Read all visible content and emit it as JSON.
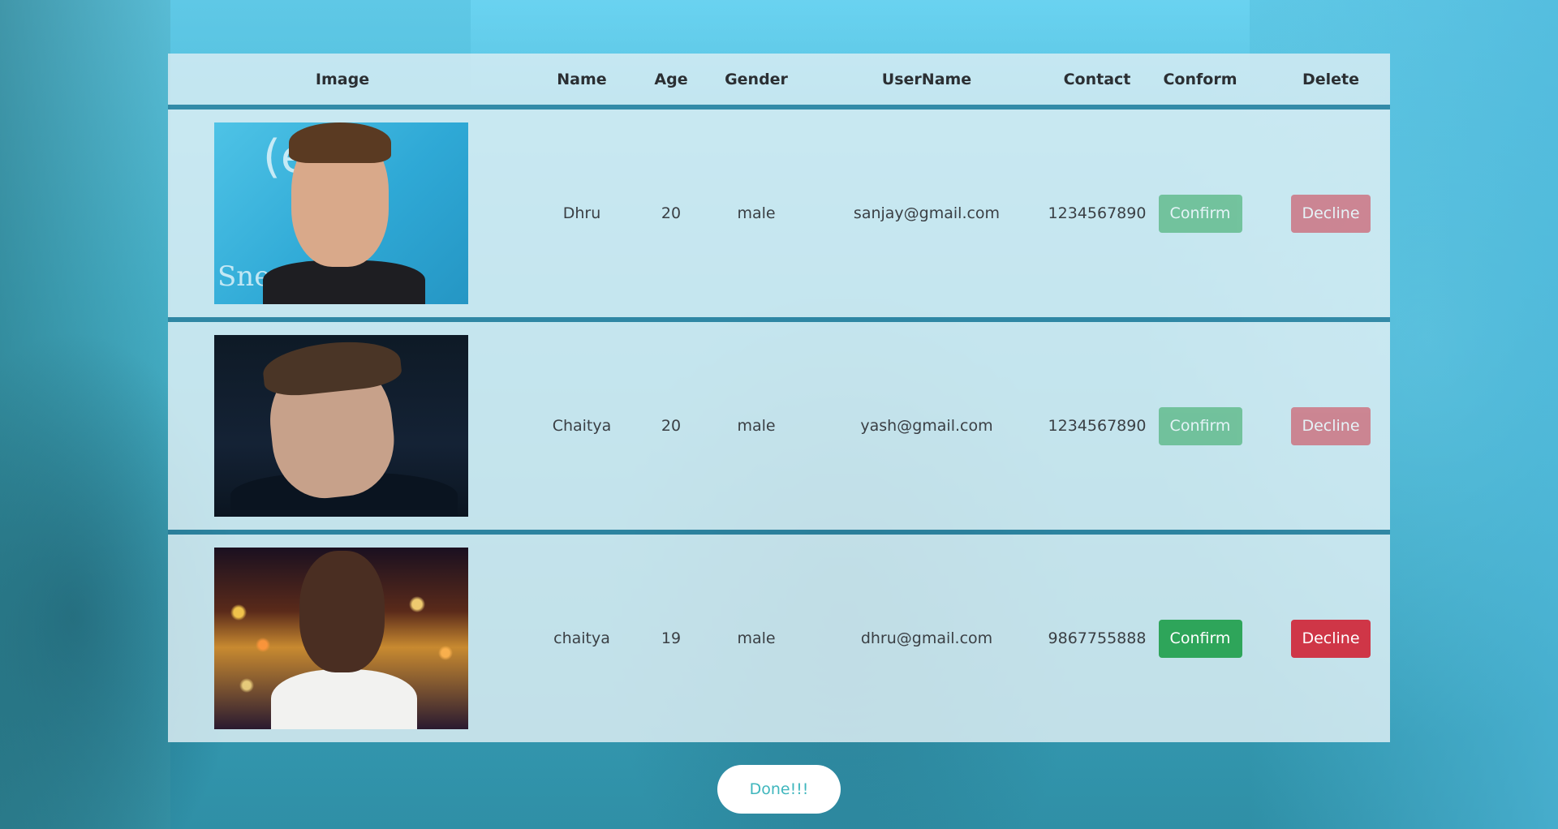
{
  "table": {
    "headers": {
      "image": "Image",
      "name": "Name",
      "age": "Age",
      "gender": "Gender",
      "username": "UserName",
      "contact": "Contact",
      "conform": "Conform",
      "delete": "Delete"
    },
    "rows": [
      {
        "name": "Dhru",
        "age": "20",
        "gender": "male",
        "username": "sanjay@gmail.com",
        "contact": "1234567890",
        "confirm_label": "Confirm",
        "decline_label": "Decline"
      },
      {
        "name": "Chaitya",
        "age": "20",
        "gender": "male",
        "username": "yash@gmail.com",
        "contact": "1234567890",
        "confirm_label": "Confirm",
        "decline_label": "Decline"
      },
      {
        "name": "chaitya",
        "age": "19",
        "gender": "male",
        "username": "dhru@gmail.com",
        "contact": "9867755888",
        "confirm_label": "Confirm",
        "decline_label": "Decline"
      }
    ]
  },
  "done_label": "Done!!!",
  "colors": {
    "confirm": "#2ea55a",
    "decline": "#cf3647",
    "done_text": "#3fb6bd",
    "header_separator": "#28789a"
  }
}
